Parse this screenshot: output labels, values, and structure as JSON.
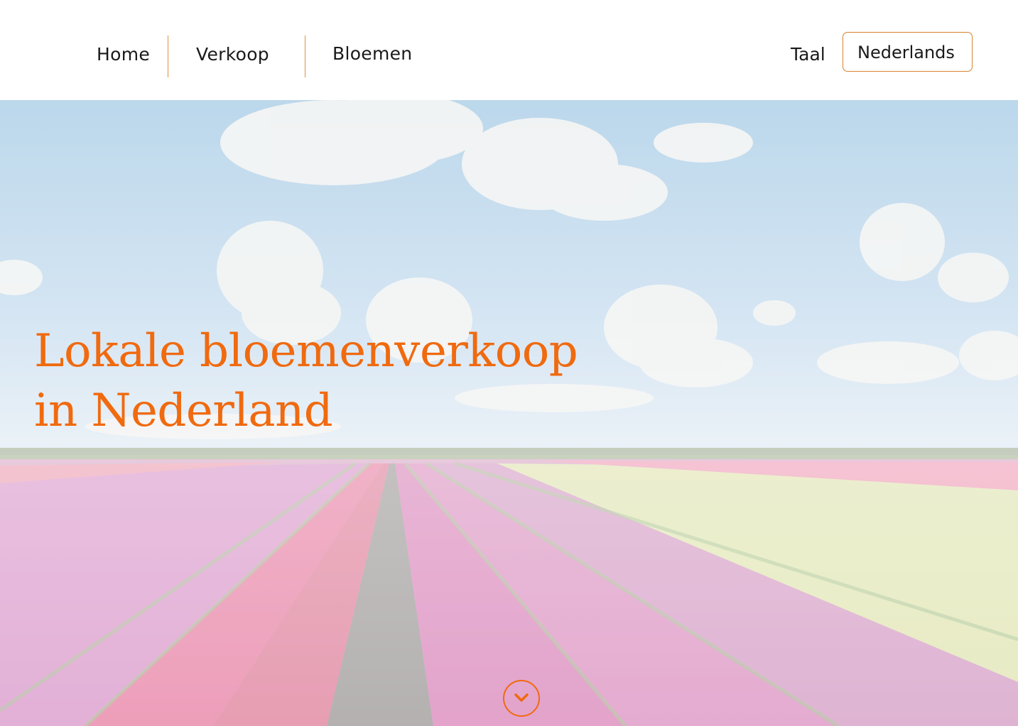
{
  "nav": {
    "items": [
      {
        "label": "Home"
      },
      {
        "label": "Verkoop"
      },
      {
        "label": "Bloemen"
      }
    ]
  },
  "language": {
    "label": "Taal",
    "selected": "Nederlands"
  },
  "hero": {
    "title_line1": "Lokale bloemenverkoop",
    "title_line2": "in Nederland",
    "scroll_icon": "chevron-down-icon"
  },
  "colors": {
    "accent": "#f06a0f",
    "divider": "#e0913c"
  }
}
